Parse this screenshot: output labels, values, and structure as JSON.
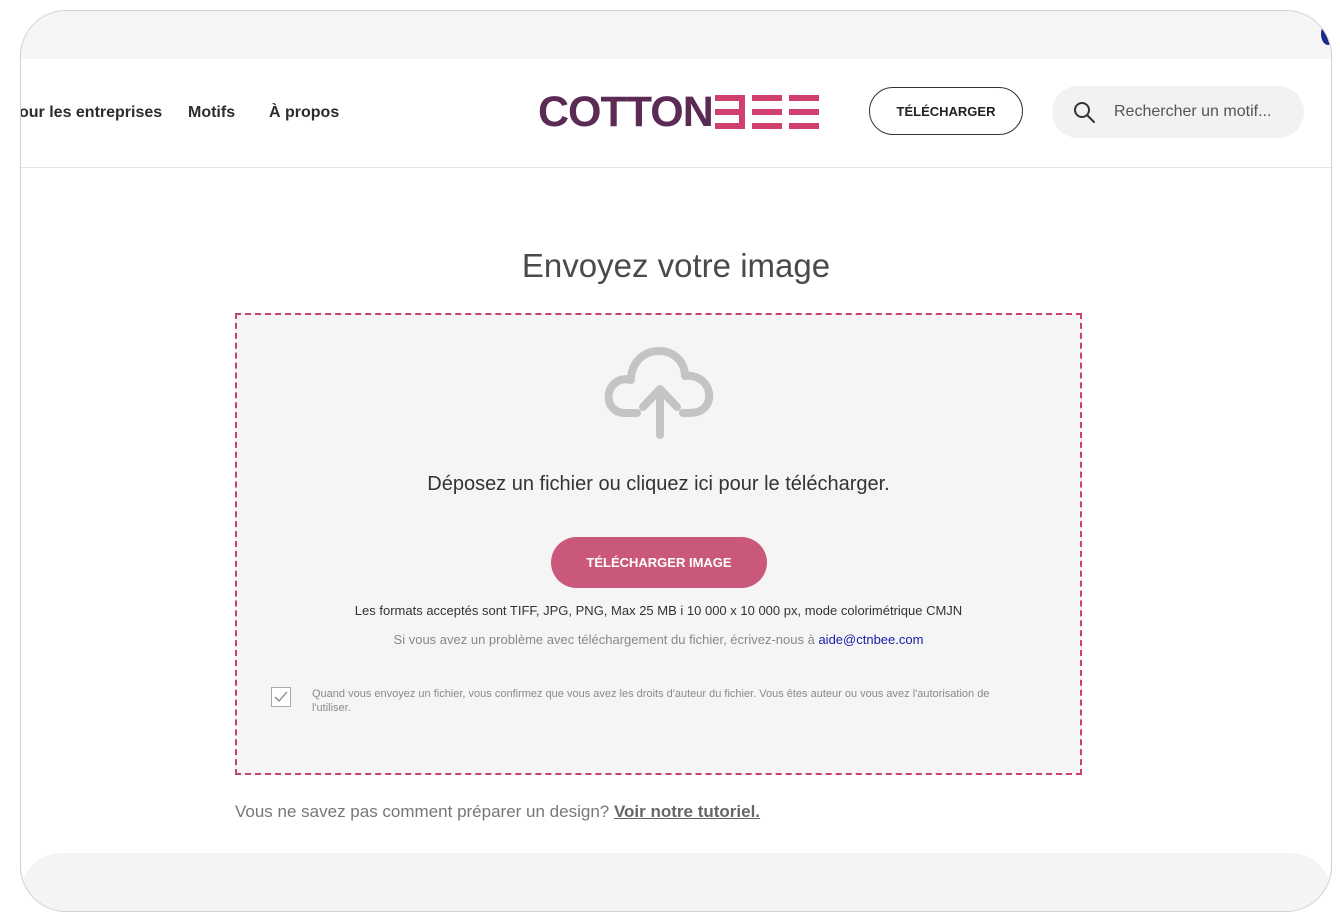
{
  "nav": {
    "items": [
      {
        "label": "our les entreprises"
      },
      {
        "label": "Motifs"
      },
      {
        "label": "À propos"
      }
    ]
  },
  "logo": {
    "part1": "COTTON",
    "part2": "ƐƐƐ"
  },
  "header": {
    "download_label": "TÉLÉCHARGER",
    "search_placeholder": "Rechercher un motif..."
  },
  "main": {
    "title": "Envoyez votre image",
    "drop_text": "Déposez un fichier ou cliquez ici pour le télécharger.",
    "upload_button": "TÉLÉCHARGER IMAGE",
    "formats_note": "Les formats acceptés sont TIFF, JPG, PNG, Max 25 MB i 10 000 x 10 000 px, mode colorimétrique CMJN",
    "problem_note": "Si vous avez un problème avec téléchargement du fichier, écrivez-nous à ",
    "support_email": "aide@ctnbee.com",
    "consent_checked": true,
    "consent_text": "Quand vous envoyez un fichier, vous confirmez que vous avez les droits d'auteur du fichier. Vous êtes auteur ou vous avez l'autorisation de l'utiliser.",
    "tutorial_prompt": "Vous ne savez pas comment préparer un design? ",
    "tutorial_link": "Voir notre tutoriel."
  },
  "colors": {
    "brand_purple": "#5b2b55",
    "brand_pink": "#d0416d",
    "button_pink": "#c9587a",
    "dashed_border": "#c8426a",
    "link_blue": "#1a1aa6"
  },
  "icons": [
    "search-icon",
    "cloud-upload-icon",
    "checkmark-icon"
  ]
}
